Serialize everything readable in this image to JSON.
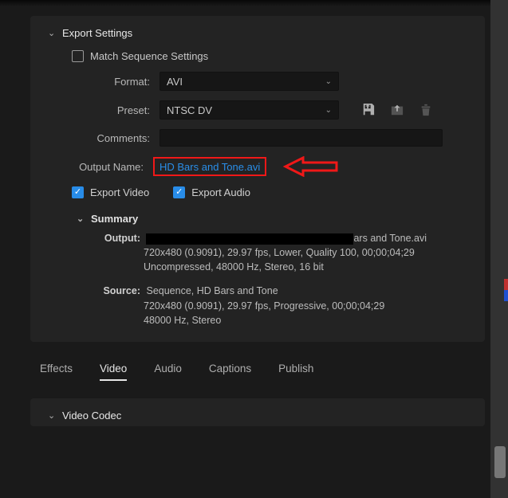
{
  "export": {
    "title": "Export Settings",
    "match_sequence_label": "Match Sequence Settings",
    "format_label": "Format:",
    "format_value": "AVI",
    "preset_label": "Preset:",
    "preset_value": "NTSC DV",
    "comments_label": "Comments:",
    "output_name_label": "Output Name:",
    "output_name_value": "HD Bars and Tone.avi",
    "export_video_label": "Export Video",
    "export_audio_label": "Export Audio"
  },
  "summary": {
    "title": "Summary",
    "output_label": "Output:",
    "output_suffix": "ars and Tone.avi",
    "output_line2": "720x480 (0.9091), 29.97 fps, Lower, Quality 100, 00;00;04;29",
    "output_line3": "Uncompressed, 48000 Hz, Stereo, 16 bit",
    "source_label": "Source:",
    "source_line1": "Sequence, HD Bars and Tone",
    "source_line2": "720x480 (0.9091), 29.97 fps, Progressive, 00;00;04;29",
    "source_line3": "48000 Hz, Stereo"
  },
  "tabs": {
    "effects": "Effects",
    "video": "Video",
    "audio": "Audio",
    "captions": "Captions",
    "publish": "Publish"
  },
  "codec": {
    "title": "Video Codec"
  }
}
